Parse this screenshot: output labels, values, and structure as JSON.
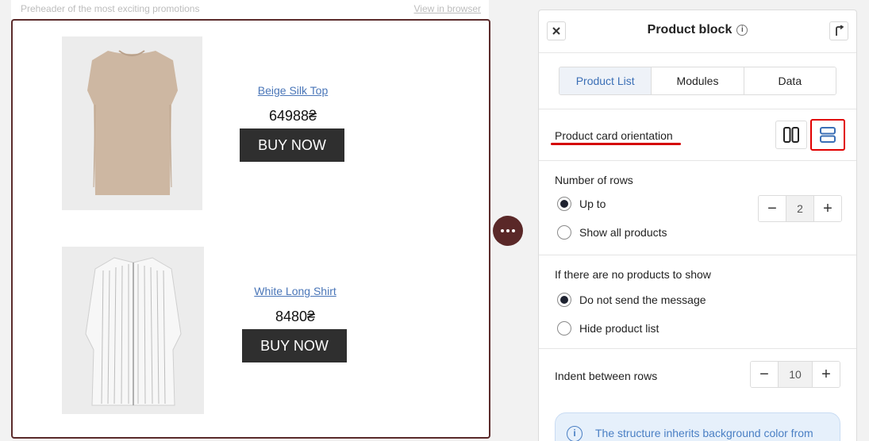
{
  "email": {
    "preheader": "Preheader of the most exciting promotions",
    "view_in_browser": "View in browser",
    "products": [
      {
        "name": "Beige Silk Top",
        "price": "64988₴",
        "button": "BUY NOW"
      },
      {
        "name": "White Long Shirt",
        "price": "8480₴",
        "button": "BUY NOW"
      }
    ]
  },
  "panel": {
    "title": "Product block",
    "tabs": [
      {
        "label": "Product List",
        "active": true
      },
      {
        "label": "Modules",
        "active": false
      },
      {
        "label": "Data",
        "active": false
      }
    ],
    "orientation": {
      "label": "Product card orientation",
      "options": [
        "horizontal-columns",
        "vertical-rows"
      ],
      "selected": "vertical-rows"
    },
    "rows": {
      "label": "Number of rows",
      "options": [
        "Up to",
        "Show all products"
      ],
      "selected": "Up to",
      "value": "2"
    },
    "no_products": {
      "label": "If there are no products to show",
      "options": [
        "Do not send the message",
        "Hide product list"
      ],
      "selected": "Do not send the message"
    },
    "indent": {
      "label": "Indent between rows",
      "value": "10"
    },
    "notice": "The structure inherits background color from"
  },
  "colors": {
    "accent": "#3b6fb6",
    "block_border": "#5b2b2b",
    "highlight": "#e10000"
  }
}
